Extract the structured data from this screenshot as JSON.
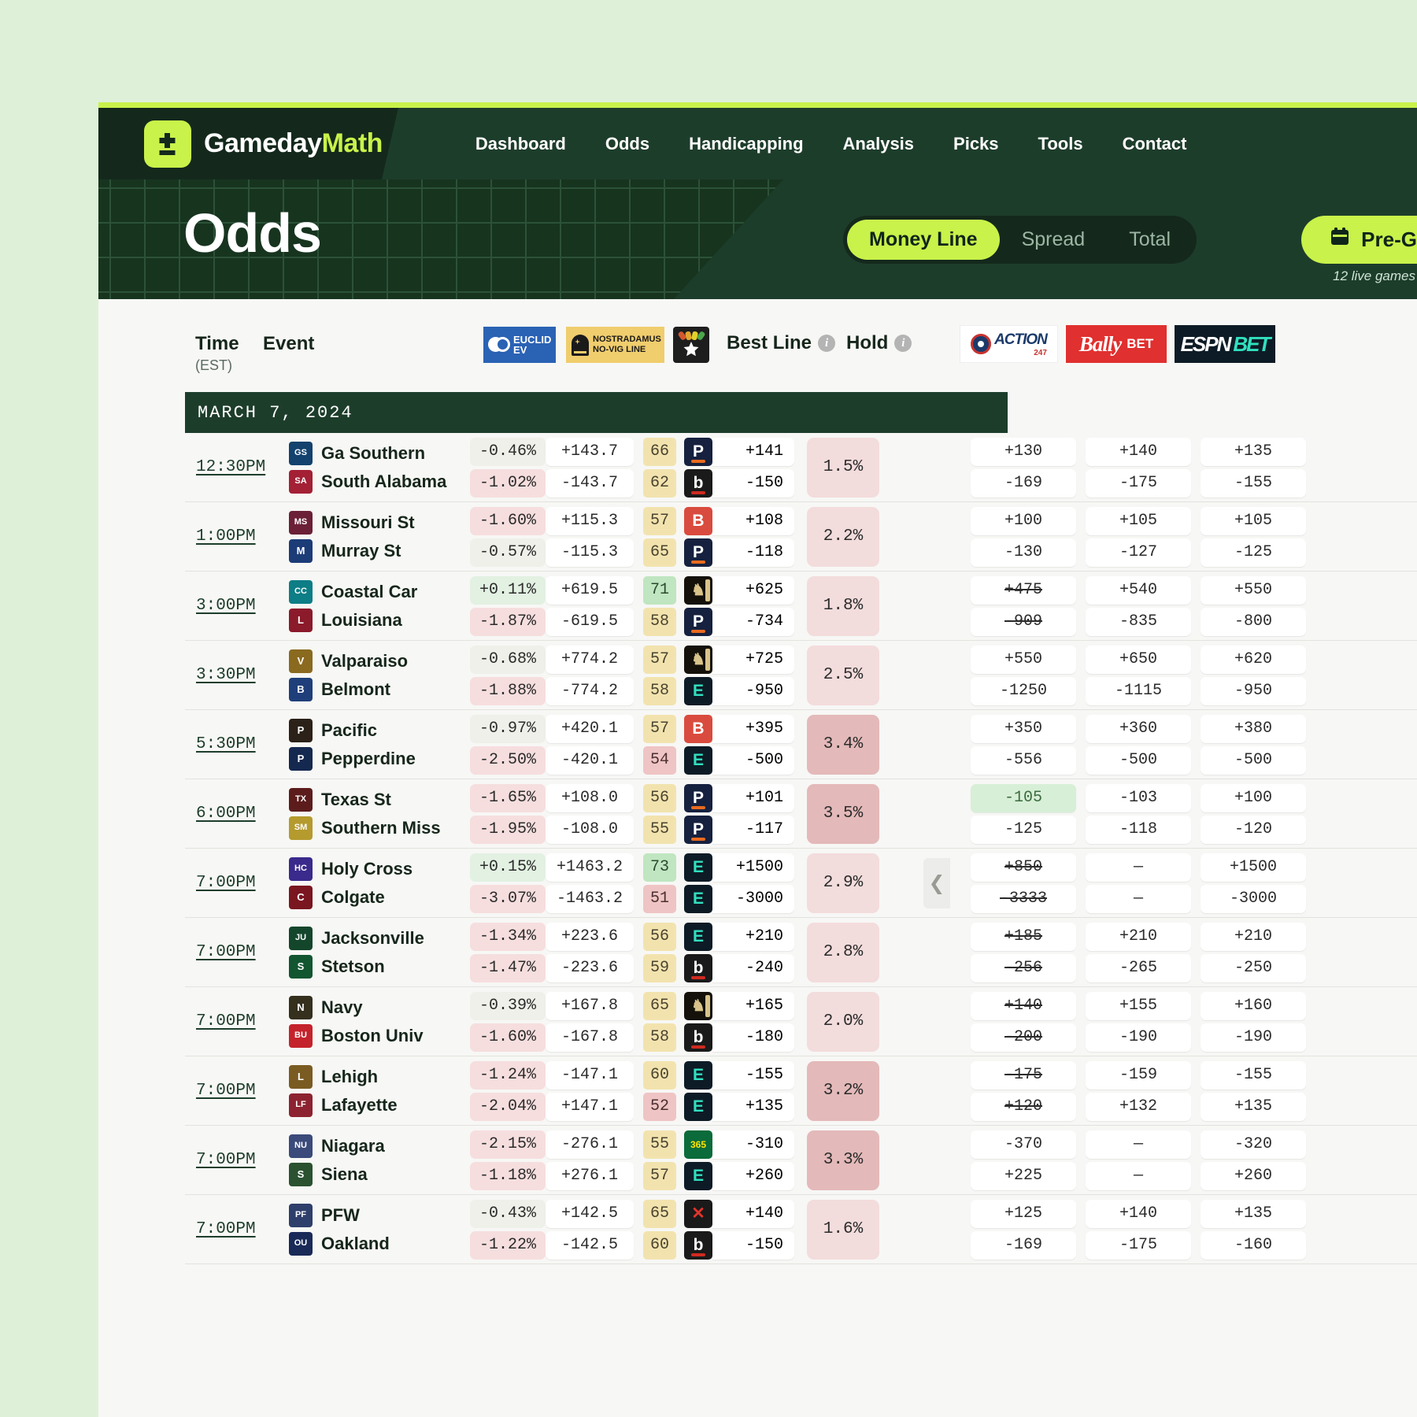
{
  "brand": {
    "word1": "Gameday",
    "word2": "Math",
    "logo_icon": "plus-minus-icon"
  },
  "nav": {
    "items": [
      "Dashboard",
      "Odds",
      "Handicapping",
      "Analysis",
      "Picks",
      "Tools",
      "Contact"
    ]
  },
  "page": {
    "title": "Odds",
    "segments": [
      {
        "label": "Money Line",
        "active": true
      },
      {
        "label": "Spread",
        "active": false
      },
      {
        "label": "Total",
        "active": false
      }
    ],
    "pregame_button": {
      "label": "Pre-Game",
      "icon": "calendar-icon"
    },
    "live_note": "12 live games"
  },
  "columns": {
    "time": "Time",
    "time_sub": "(EST)",
    "event": "Event",
    "euclid": {
      "line1": "EUCLID",
      "line2": "EV"
    },
    "nostradamus": {
      "line1": "NOSTRADAMUS",
      "line2": "NO-VIG LINE"
    },
    "star_icon": "star-rating-icon",
    "best_line": "Best Line",
    "hold": "Hold",
    "books": [
      {
        "name": "ACTION",
        "sub": "247"
      },
      {
        "name": "Bally",
        "sub": "BET"
      },
      {
        "name": "ESPN",
        "sub": "BET"
      }
    ]
  },
  "date_band": "MARCH 7, 2024",
  "colors": {
    "accent": "#c9f24a",
    "header_dark": "#1d3d2b",
    "page_bg": "#dff0d8",
    "best_green": "#d7efd7",
    "hold_pink": "#f3dcdc"
  },
  "games": [
    {
      "time": "12:30PM",
      "hold": "1.5%",
      "hold_bg": "#f3dcdc",
      "teams": [
        {
          "name": "Ga Southern",
          "logo_text": "GS",
          "logo_bg": "#13426e",
          "ev": "-0.46%",
          "ev_style": "neg-light",
          "novig": "+143.7",
          "score": "66",
          "score_style": "yellow",
          "book": "pointsbet",
          "book_label": "P",
          "best_odds": "+141",
          "books": [
            {
              "v": "+130"
            },
            {
              "v": "+140"
            },
            {
              "v": "+135"
            }
          ]
        },
        {
          "name": "South Alabama",
          "logo_text": "SA",
          "logo_bg": "#a32035",
          "ev": "-1.02%",
          "ev_style": "neg",
          "novig": "-143.7",
          "score": "62",
          "score_style": "yellow",
          "book": "betrivers",
          "book_label": "b",
          "best_odds": "-150",
          "books": [
            {
              "v": "-169"
            },
            {
              "v": "-175"
            },
            {
              "v": "-155"
            }
          ]
        }
      ]
    },
    {
      "time": "1:00PM",
      "hold": "2.2%",
      "hold_bg": "#f3dcdc",
      "teams": [
        {
          "name": "Missouri St",
          "logo_text": "MS",
          "logo_bg": "#6b2038",
          "ev": "-1.60%",
          "ev_style": "neg",
          "novig": "+115.3",
          "score": "57",
          "score_style": "yellow",
          "book": "betmgm",
          "book_label": "B",
          "best_odds": "+108",
          "books": [
            {
              "v": "+100"
            },
            {
              "v": "+105"
            },
            {
              "v": "+105"
            }
          ]
        },
        {
          "name": "Murray St",
          "logo_text": "M",
          "logo_bg": "#1c3c78",
          "ev": "-0.57%",
          "ev_style": "neg-light",
          "novig": "-115.3",
          "score": "65",
          "score_style": "yellow",
          "book": "pointsbet",
          "book_label": "P",
          "best_odds": "-118",
          "books": [
            {
              "v": "-130"
            },
            {
              "v": "-127"
            },
            {
              "v": "-125"
            }
          ]
        }
      ]
    },
    {
      "time": "3:00PM",
      "hold": "1.8%",
      "hold_bg": "#f3dcdc",
      "teams": [
        {
          "name": "Coastal Car",
          "logo_text": "CC",
          "logo_bg": "#0d7d86",
          "ev": "+0.11%",
          "ev_style": "pos",
          "novig": "+619.5",
          "score": "71",
          "score_style": "green",
          "book": "caesars",
          "book_label": "C",
          "best_odds": "+625",
          "books": [
            {
              "v": "+475",
              "stale": true
            },
            {
              "v": "+540"
            },
            {
              "v": "+550"
            }
          ]
        },
        {
          "name": "Louisiana",
          "logo_text": "L",
          "logo_bg": "#8b1a2b",
          "ev": "-1.87%",
          "ev_style": "neg",
          "novig": "-619.5",
          "score": "58",
          "score_style": "yellow",
          "book": "pointsbet",
          "book_label": "P",
          "best_odds": "-734",
          "books": [
            {
              "v": "-909",
              "stale": true
            },
            {
              "v": "-835"
            },
            {
              "v": "-800"
            }
          ]
        }
      ]
    },
    {
      "time": "3:30PM",
      "hold": "2.5%",
      "hold_bg": "#f3dcdc",
      "teams": [
        {
          "name": "Valparaiso",
          "logo_text": "V",
          "logo_bg": "#8a6a1f",
          "ev": "-0.68%",
          "ev_style": "neg-light",
          "novig": "+774.2",
          "score": "57",
          "score_style": "yellow",
          "book": "caesars",
          "book_label": "C",
          "best_odds": "+725",
          "books": [
            {
              "v": "+550"
            },
            {
              "v": "+650"
            },
            {
              "v": "+620"
            }
          ]
        },
        {
          "name": "Belmont",
          "logo_text": "B",
          "logo_bg": "#1f3f7a",
          "ev": "-1.88%",
          "ev_style": "neg",
          "novig": "-774.2",
          "score": "58",
          "score_style": "yellow",
          "book": "espnbet",
          "book_label": "E",
          "best_odds": "-950",
          "books": [
            {
              "v": "-1250"
            },
            {
              "v": "-1115"
            },
            {
              "v": "-950"
            }
          ]
        }
      ]
    },
    {
      "time": "5:30PM",
      "hold": "3.4%",
      "hold_bg": "#e4b9b9",
      "teams": [
        {
          "name": "Pacific",
          "logo_text": "P",
          "logo_bg": "#2b2118",
          "ev": "-0.97%",
          "ev_style": "neg-light",
          "novig": "+420.1",
          "score": "57",
          "score_style": "yellow",
          "book": "betmgm",
          "book_label": "B",
          "best_odds": "+395",
          "books": [
            {
              "v": "+350"
            },
            {
              "v": "+360"
            },
            {
              "v": "+380"
            }
          ]
        },
        {
          "name": "Pepperdine",
          "logo_text": "P",
          "logo_bg": "#15284f",
          "ev": "-2.50%",
          "ev_style": "neg",
          "novig": "-420.1",
          "score": "54",
          "score_style": "pink",
          "book": "espnbet",
          "book_label": "E",
          "best_odds": "-500",
          "books": [
            {
              "v": "-556"
            },
            {
              "v": "-500"
            },
            {
              "v": "-500"
            }
          ]
        }
      ]
    },
    {
      "time": "6:00PM",
      "hold": "3.5%",
      "hold_bg": "#e4b9b9",
      "teams": [
        {
          "name": "Texas St",
          "logo_text": "TX",
          "logo_bg": "#5c1c1c",
          "ev": "-1.65%",
          "ev_style": "neg",
          "novig": "+108.0",
          "score": "56",
          "score_style": "yellow",
          "book": "pointsbet",
          "book_label": "P",
          "best_odds": "+101",
          "books": [
            {
              "v": "-105",
              "best": true
            },
            {
              "v": "-103"
            },
            {
              "v": "+100"
            }
          ]
        },
        {
          "name": "Southern Miss",
          "logo_text": "SM",
          "logo_bg": "#b59a2e",
          "ev": "-1.95%",
          "ev_style": "neg",
          "novig": "-108.0",
          "score": "55",
          "score_style": "yellow",
          "book": "pointsbet",
          "book_label": "P",
          "best_odds": "-117",
          "books": [
            {
              "v": "-125"
            },
            {
              "v": "-118"
            },
            {
              "v": "-120"
            }
          ]
        }
      ]
    },
    {
      "time": "7:00PM",
      "hold": "2.9%",
      "hold_bg": "#f3dcdc",
      "teams": [
        {
          "name": "Holy Cross",
          "logo_text": "HC",
          "logo_bg": "#3a2a8c",
          "ev": "+0.15%",
          "ev_style": "pos",
          "novig": "+1463.2",
          "score": "73",
          "score_style": "green",
          "book": "espnbet",
          "book_label": "E",
          "best_odds": "+1500",
          "books": [
            {
              "v": "+850",
              "stale": true
            },
            {
              "v": "—"
            },
            {
              "v": "+1500"
            }
          ]
        },
        {
          "name": "Colgate",
          "logo_text": "C",
          "logo_bg": "#7a1620",
          "ev": "-3.07%",
          "ev_style": "neg",
          "novig": "-1463.2",
          "score": "51",
          "score_style": "pink",
          "book": "espnbet",
          "book_label": "E",
          "best_odds": "-3000",
          "books": [
            {
              "v": "-3333",
              "stale": true
            },
            {
              "v": "—"
            },
            {
              "v": "-3000"
            }
          ]
        }
      ]
    },
    {
      "time": "7:00PM",
      "hold": "2.8%",
      "hold_bg": "#f3dcdc",
      "teams": [
        {
          "name": "Jacksonville",
          "logo_text": "JU",
          "logo_bg": "#14462c",
          "ev": "-1.34%",
          "ev_style": "neg",
          "novig": "+223.6",
          "score": "56",
          "score_style": "yellow",
          "book": "espnbet",
          "book_label": "E",
          "best_odds": "+210",
          "books": [
            {
              "v": "+185",
              "stale": true
            },
            {
              "v": "+210"
            },
            {
              "v": "+210"
            }
          ]
        },
        {
          "name": "Stetson",
          "logo_text": "S",
          "logo_bg": "#115631",
          "ev": "-1.47%",
          "ev_style": "neg",
          "novig": "-223.6",
          "score": "59",
          "score_style": "yellow",
          "book": "betrivers",
          "book_label": "b",
          "best_odds": "-240",
          "books": [
            {
              "v": "-256",
              "stale": true
            },
            {
              "v": "-265"
            },
            {
              "v": "-250"
            }
          ]
        }
      ]
    },
    {
      "time": "7:00PM",
      "hold": "2.0%",
      "hold_bg": "#f3dcdc",
      "teams": [
        {
          "name": "Navy",
          "logo_text": "N",
          "logo_bg": "#352f1e",
          "ev": "-0.39%",
          "ev_style": "neg-light",
          "novig": "+167.8",
          "score": "65",
          "score_style": "yellow",
          "book": "caesars",
          "book_label": "C",
          "best_odds": "+165",
          "books": [
            {
              "v": "+140",
              "stale": true
            },
            {
              "v": "+155"
            },
            {
              "v": "+160"
            }
          ]
        },
        {
          "name": "Boston Univ",
          "logo_text": "BU",
          "logo_bg": "#c4232b",
          "ev": "-1.60%",
          "ev_style": "neg",
          "novig": "-167.8",
          "score": "58",
          "score_style": "yellow",
          "book": "betrivers",
          "book_label": "b",
          "best_odds": "-180",
          "books": [
            {
              "v": "-200",
              "stale": true
            },
            {
              "v": "-190"
            },
            {
              "v": "-190"
            }
          ]
        }
      ]
    },
    {
      "time": "7:00PM",
      "hold": "3.2%",
      "hold_bg": "#e4b9b9",
      "teams": [
        {
          "name": "Lehigh",
          "logo_text": "L",
          "logo_bg": "#7a5c22",
          "ev": "-1.24%",
          "ev_style": "neg",
          "novig": "-147.1",
          "score": "60",
          "score_style": "yellow",
          "book": "espnbet",
          "book_label": "E",
          "best_odds": "-155",
          "books": [
            {
              "v": "-175",
              "stale": true
            },
            {
              "v": "-159"
            },
            {
              "v": "-155"
            }
          ]
        },
        {
          "name": "Lafayette",
          "logo_text": "LF",
          "logo_bg": "#8d2330",
          "ev": "-2.04%",
          "ev_style": "neg",
          "novig": "+147.1",
          "score": "52",
          "score_style": "pink",
          "book": "espnbet",
          "book_label": "E",
          "best_odds": "+135",
          "books": [
            {
              "v": "+120",
              "stale": true
            },
            {
              "v": "+132"
            },
            {
              "v": "+135"
            }
          ]
        }
      ]
    },
    {
      "time": "7:00PM",
      "hold": "3.3%",
      "hold_bg": "#e4b9b9",
      "teams": [
        {
          "name": "Niagara",
          "logo_text": "NU",
          "logo_bg": "#3a4a7a",
          "ev": "-2.15%",
          "ev_style": "neg",
          "novig": "-276.1",
          "score": "55",
          "score_style": "yellow",
          "book": "bet365",
          "book_label": "365",
          "best_odds": "-310",
          "books": [
            {
              "v": "-370"
            },
            {
              "v": "—"
            },
            {
              "v": "-320"
            }
          ]
        },
        {
          "name": "Siena",
          "logo_text": "S",
          "logo_bg": "#2a5130",
          "ev": "-1.18%",
          "ev_style": "neg",
          "novig": "+276.1",
          "score": "57",
          "score_style": "yellow",
          "book": "espnbet",
          "book_label": "E",
          "best_odds": "+260",
          "books": [
            {
              "v": "+225"
            },
            {
              "v": "—"
            },
            {
              "v": "+260"
            }
          ]
        }
      ]
    },
    {
      "time": "7:00PM",
      "hold": "1.6%",
      "hold_bg": "#f3dcdc",
      "teams": [
        {
          "name": "PFW",
          "logo_text": "PF",
          "logo_bg": "#2e3f6b",
          "ev": "-0.43%",
          "ev_style": "neg-light",
          "novig": "+142.5",
          "score": "65",
          "score_style": "yellow",
          "book": "fanatics",
          "book_label": "X",
          "best_odds": "+140",
          "books": [
            {
              "v": "+125"
            },
            {
              "v": "+140"
            },
            {
              "v": "+135"
            }
          ]
        },
        {
          "name": "Oakland",
          "logo_text": "OU",
          "logo_bg": "#1a2a58",
          "ev": "-1.22%",
          "ev_style": "neg",
          "novig": "-142.5",
          "score": "60",
          "score_style": "yellow",
          "book": "betrivers",
          "book_label": "b",
          "best_odds": "-150",
          "books": [
            {
              "v": "-169"
            },
            {
              "v": "-175"
            },
            {
              "v": "-160"
            }
          ]
        }
      ]
    }
  ],
  "collapse_icon": "chevron-left-icon"
}
